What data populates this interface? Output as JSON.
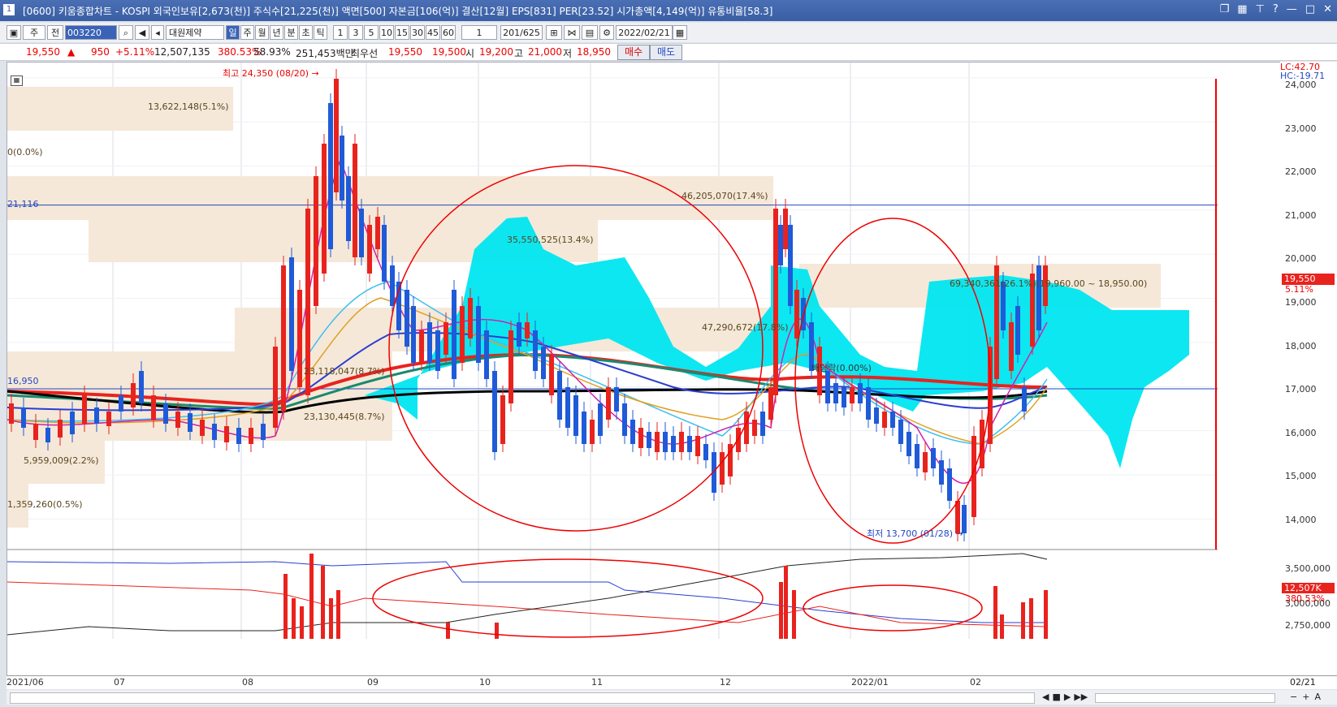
{
  "window": {
    "title": "[0600] 키움종합차트 - KOSPI 외국인보유[2,673(천)] 주식수[21,225(천)] 액면[500] 자본금[106(억)] 결산[12월] EPS[831] PER[23.52] 시가총액[4,149(억)] 유통비율[58.3]",
    "sys_label": "1"
  },
  "toolbar": {
    "type_label": "주",
    "mode_label": "전",
    "code": "003220",
    "stock_name": "대원제약",
    "periods": [
      "일",
      "주",
      "월",
      "년",
      "분",
      "초",
      "틱"
    ],
    "intervals": [
      "1",
      "3",
      "5",
      "10",
      "15",
      "30",
      "45",
      "60"
    ],
    "count_value": "1",
    "range": "201/625",
    "date": "2022/02/21"
  },
  "quote": {
    "price": "19,550",
    "change": "950",
    "change_pct": "+5.11%",
    "volume": "12,507,135",
    "vol_ratio": "380.53%",
    "turnover": "58.93%",
    "amount": "251,453백만",
    "best_label": "최우선",
    "bid1": "19,550",
    "bid2": "19,500",
    "open_label": "시",
    "open": "19,200",
    "high_label": "고",
    "high": "21,000",
    "low_label": "저",
    "low": "18,950",
    "buy_label": "매수",
    "sell_label": "매도"
  },
  "price_axis": {
    "labels": [
      "24,000",
      "23,000",
      "22,000",
      "21,000",
      "20,000",
      "19,000",
      "18,000",
      "17,000",
      "16,000",
      "15,000",
      "14,000"
    ],
    "lc": "LC:42.70",
    "hc": "HC:-19.71",
    "current": "19,550",
    "current_pct": "5.11%"
  },
  "volume_axis": {
    "labels": [
      "3,500,000",
      "3,000,000",
      "2,750,000"
    ],
    "current": "12,507K",
    "current_pct": "380.53%"
  },
  "x_axis": {
    "labels": [
      "2021/06",
      "07",
      "08",
      "09",
      "10",
      "11",
      "12",
      "2022/01",
      "02",
      "02/21"
    ]
  },
  "annotations": {
    "high": "최고 24,350 (08/20)",
    "low": "최저 13,700 (01/28)",
    "dividend": "배당락(0.00%)",
    "line_21116": "21,116",
    "line_16950": "16,950",
    "volume_profile": [
      "13,622,148(5.1%)",
      "0(0.0%)",
      "46,205,070(17.4%)",
      "35,550,525(13.4%)",
      "69,340,361(26.1%)(19,960.00 ~ 18,950.00)",
      "47,290,672(17.8%)",
      "23,118,047(8.7%)",
      "23,130,445(8.7%)",
      "5,959,009(2.2%)",
      "1,359,260(0.5%)"
    ]
  },
  "colors": {
    "up": "#e8231e",
    "down": "#1f5ad8",
    "cloud": "#00e6f0",
    "profile": "#f5e8d8",
    "ma_long": "#000000",
    "ma_red": "#e8231e",
    "ma_green": "#1a8a6e"
  }
}
